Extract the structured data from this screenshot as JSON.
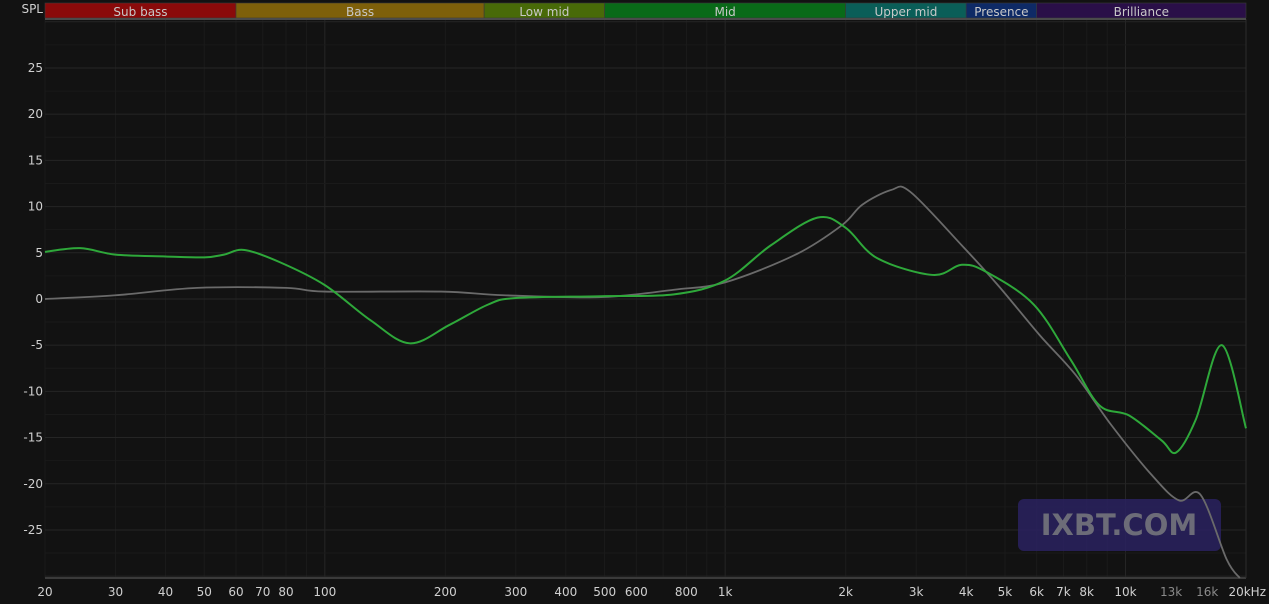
{
  "chart_data": {
    "type": "line",
    "ylabel": "SPL",
    "x_scale": "log",
    "xlim": [
      20,
      20000
    ],
    "ylim": [
      -30.2,
      30.3
    ],
    "grid": true,
    "x_ticks": [
      {
        "value": 20,
        "label": "20"
      },
      {
        "value": 30,
        "label": "30"
      },
      {
        "value": 40,
        "label": "40"
      },
      {
        "value": 50,
        "label": "50"
      },
      {
        "value": 60,
        "label": "60"
      },
      {
        "value": 70,
        "label": "70"
      },
      {
        "value": 80,
        "label": "80"
      },
      {
        "value": 100,
        "label": "100"
      },
      {
        "value": 200,
        "label": "200"
      },
      {
        "value": 300,
        "label": "300"
      },
      {
        "value": 400,
        "label": "400"
      },
      {
        "value": 500,
        "label": "500"
      },
      {
        "value": 600,
        "label": "600"
      },
      {
        "value": 800,
        "label": "800"
      },
      {
        "value": 1000,
        "label": "1k"
      },
      {
        "value": 2000,
        "label": "2k"
      },
      {
        "value": 3000,
        "label": "3k"
      },
      {
        "value": 4000,
        "label": "4k"
      },
      {
        "value": 5000,
        "label": "5k"
      },
      {
        "value": 6000,
        "label": "6k"
      },
      {
        "value": 7000,
        "label": "7k"
      },
      {
        "value": 8000,
        "label": "8k"
      },
      {
        "value": 10000,
        "label": "10k"
      },
      {
        "value": 13000,
        "label": "13k",
        "dim": true
      },
      {
        "value": 16000,
        "label": "16k",
        "dim": true
      },
      {
        "value": 20000,
        "label": "20kHz"
      }
    ],
    "y_ticks": [
      25,
      20,
      15,
      10,
      5,
      0,
      -5,
      -10,
      -15,
      -20,
      -25
    ],
    "bands": [
      {
        "label": "Sub bass",
        "from": 20,
        "to": 60,
        "color": "#8a0a0a"
      },
      {
        "label": "Bass",
        "from": 60,
        "to": 250,
        "color": "#7e600a"
      },
      {
        "label": "Low mid",
        "from": 250,
        "to": 500,
        "color": "#486a08"
      },
      {
        "label": "Mid",
        "from": 500,
        "to": 2000,
        "color": "#096a18"
      },
      {
        "label": "Upper mid",
        "from": 2000,
        "to": 4000,
        "color": "#0a5e58"
      },
      {
        "label": "Presence",
        "from": 4000,
        "to": 6000,
        "color": "#0e2a66"
      },
      {
        "label": "Brilliance",
        "from": 6000,
        "to": 20000,
        "color": "#2a0f48"
      }
    ],
    "series": [
      {
        "color": "#2ea83a",
        "x": [
          20,
          24.5,
          30,
          40,
          50,
          56,
          63,
          77,
          100,
          130,
          163,
          205,
          256,
          300,
          490,
          745,
          1000,
          1300,
          1700,
          2000,
          2400,
          3300,
          3900,
          4500,
          5900,
          7300,
          8600,
          10200,
          12300,
          13400,
          15000,
          17400,
          20000
        ],
        "y": [
          5.1,
          5.5,
          4.8,
          4.6,
          4.5,
          4.8,
          5.3,
          4,
          1.5,
          -2.3,
          -4.8,
          -2.8,
          -0.6,
          0.1,
          0.3,
          0.5,
          2,
          5.8,
          8.8,
          7.7,
          4.4,
          2.6,
          3.7,
          2.9,
          -0.6,
          -6.6,
          -11.5,
          -12.6,
          -15.3,
          -16.6,
          -13,
          -5,
          -14
        ]
      },
      {
        "color": "#6a6a6a",
        "x": [
          20,
          30,
          48,
          80,
          100,
          195,
          280,
          490,
          745,
          1000,
          1500,
          1960,
          2200,
          2600,
          2900,
          3900,
          4800,
          6100,
          7500,
          9200,
          11600,
          13600,
          15400,
          17900,
          19300
        ],
        "y": [
          0,
          0.4,
          1.2,
          1.2,
          0.8,
          0.8,
          0.4,
          0.2,
          1,
          1.8,
          4.8,
          8,
          10.2,
          11.8,
          11.6,
          5.8,
          1.5,
          -3.9,
          -8.2,
          -13.6,
          -19,
          -21.8,
          -21.2,
          -28.2,
          -30.2
        ]
      }
    ]
  },
  "watermark": "IXBT.COM"
}
